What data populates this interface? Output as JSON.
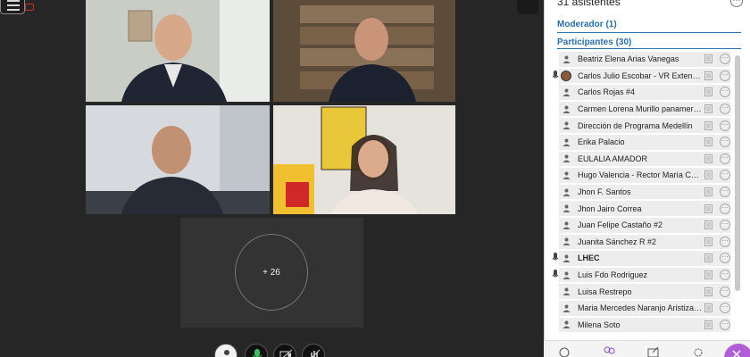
{
  "overflow": {
    "label": "+ 26"
  },
  "sidebar": {
    "title": "31 asistentes",
    "more_icon": "ellipsis-icon",
    "moderators_header": "Moderador (1)",
    "participants_header": "Participantes (30)",
    "participants": [
      {
        "name": "Beatriz Elena Arias Vanegas",
        "mic": false,
        "avatar": false,
        "bold": false
      },
      {
        "name": "Carlos Julio Escobar - VR Extensión",
        "mic": true,
        "avatar": true,
        "bold": false
      },
      {
        "name": "Carlos Rojas #4",
        "mic": false,
        "avatar": false,
        "bold": false
      },
      {
        "name": "Carmen Lorena Murillo panamericana",
        "mic": false,
        "avatar": false,
        "bold": false
      },
      {
        "name": "Dirección de Programa Medellín",
        "mic": false,
        "avatar": false,
        "bold": false
      },
      {
        "name": "Erika Palacio",
        "mic": false,
        "avatar": false,
        "bold": false
      },
      {
        "name": "EULALIA AMADOR",
        "mic": false,
        "avatar": false,
        "bold": false
      },
      {
        "name": "Hugo Valencia - Rector María Cano",
        "mic": false,
        "avatar": false,
        "bold": false
      },
      {
        "name": "Jhon F. Santos",
        "mic": false,
        "avatar": false,
        "bold": false
      },
      {
        "name": "Jhon Jairo Correa",
        "mic": false,
        "avatar": false,
        "bold": false
      },
      {
        "name": "Juan Felipe Castaño #2",
        "mic": false,
        "avatar": false,
        "bold": false
      },
      {
        "name": "Juanita Sánchez R #2",
        "mic": false,
        "avatar": false,
        "bold": false
      },
      {
        "name": "LHEC",
        "mic": true,
        "avatar": false,
        "bold": true
      },
      {
        "name": "Luis Fdo Rodriguez",
        "mic": true,
        "avatar": false,
        "bold": false
      },
      {
        "name": "Luisa Restrepo",
        "mic": false,
        "avatar": false,
        "bold": false
      },
      {
        "name": "Maria Mercedes Naranjo Aristizabal",
        "mic": false,
        "avatar": false,
        "bold": false
      },
      {
        "name": "Milena Soto",
        "mic": false,
        "avatar": false,
        "bold": false
      }
    ]
  },
  "colors": {
    "accent": "#2a6fa8",
    "close_fab": "#b25ed6",
    "stage_bg": "#262626"
  }
}
